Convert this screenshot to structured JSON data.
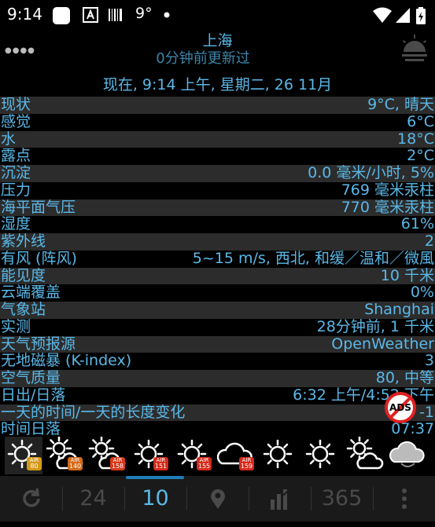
{
  "status_bar": {
    "time": "9:14",
    "temp": "9°"
  },
  "header": {
    "city": "上海",
    "updated": "0分钟前更新过"
  },
  "date_line": "现在, 9:14 上午, 星期二, 26 11月",
  "rows": [
    {
      "label": "现状",
      "value": "9°C, 晴天"
    },
    {
      "label": "感觉",
      "value": "6°C"
    },
    {
      "label": "水",
      "value": "18°C"
    },
    {
      "label": "露点",
      "value": "2°C"
    },
    {
      "label": "沉淀",
      "value": "0.0 毫米/小时, 5%"
    },
    {
      "label": "压力",
      "value": "769 毫米汞柱"
    },
    {
      "label": "海平面气压",
      "value": "770 毫米汞柱"
    },
    {
      "label": "湿度",
      "value": "61%"
    },
    {
      "label": "紫外线",
      "value": "2"
    },
    {
      "label": "有风 (阵风)",
      "value": "5~15 m/s, 西北, 和缓／温和／微風"
    },
    {
      "label": "能见度",
      "value": "10 千米"
    },
    {
      "label": "云端覆盖",
      "value": "0%"
    },
    {
      "label": "气象站",
      "value": "Shanghai"
    },
    {
      "label": "实测",
      "value": "28分钟前, 1 千米"
    },
    {
      "label": "天气预报源",
      "value": "OpenWeather"
    },
    {
      "label": "无地磁暴 (K-index)",
      "value": "3"
    },
    {
      "label": "空气质量",
      "value": "80, 中等"
    },
    {
      "label": "日出/日落",
      "value": "6:32 上午/4:52 下午"
    },
    {
      "label": "一天的时间/一天的长度变化",
      "value": "10 ‑1"
    },
    {
      "label": "时间日落",
      "value": "07:37"
    }
  ],
  "ads_badge": "ADS",
  "forecast": [
    {
      "icon": "sun-icon",
      "air_label": "AIR",
      "air": "80",
      "air_color": "#d49a17"
    },
    {
      "icon": "sun-cloud-icon",
      "air_label": "AIR",
      "air": "140",
      "air_color": "#d46a17"
    },
    {
      "icon": "sun-cloud-icon",
      "air_label": "AIR",
      "air": "158",
      "air_color": "#d43a1a"
    },
    {
      "icon": "sun-icon",
      "air_label": "AIR",
      "air": "151",
      "air_color": "#d42a1a"
    },
    {
      "icon": "sun-icon",
      "air_label": "AIR",
      "air": "155",
      "air_color": "#d42a1a"
    },
    {
      "icon": "cloud-icon",
      "air_label": "AIR",
      "air": "159",
      "air_color": "#d42a1a"
    },
    {
      "icon": "sun-icon",
      "air_label": "",
      "air": "",
      "air_color": ""
    },
    {
      "icon": "sun-icon",
      "air_label": "",
      "air": "",
      "air_color": ""
    },
    {
      "icon": "sun-cloud-icon",
      "air_label": "",
      "air": "",
      "air_color": ""
    },
    {
      "icon": "dark-cloud-icon",
      "air_label": "",
      "air": "",
      "air_color": ""
    }
  ],
  "nav": [
    {
      "name": "refresh-button",
      "icon": "refresh-icon",
      "label": ""
    },
    {
      "name": "nav-24-button",
      "icon": "",
      "label": "24"
    },
    {
      "name": "nav-10-button",
      "icon": "",
      "label": "10"
    },
    {
      "name": "nav-location-button",
      "icon": "location-pin-icon",
      "label": ""
    },
    {
      "name": "nav-chart-button",
      "icon": "chart-icon",
      "label": ""
    },
    {
      "name": "nav-365-button",
      "icon": "",
      "label": "365"
    },
    {
      "name": "nav-more-button",
      "icon": "more-vertical-icon",
      "label": ""
    }
  ],
  "colors": {
    "accent": "#5ab8e8",
    "row_stripe": "#2c2c2c",
    "nav_active": "#1f7fb6"
  }
}
